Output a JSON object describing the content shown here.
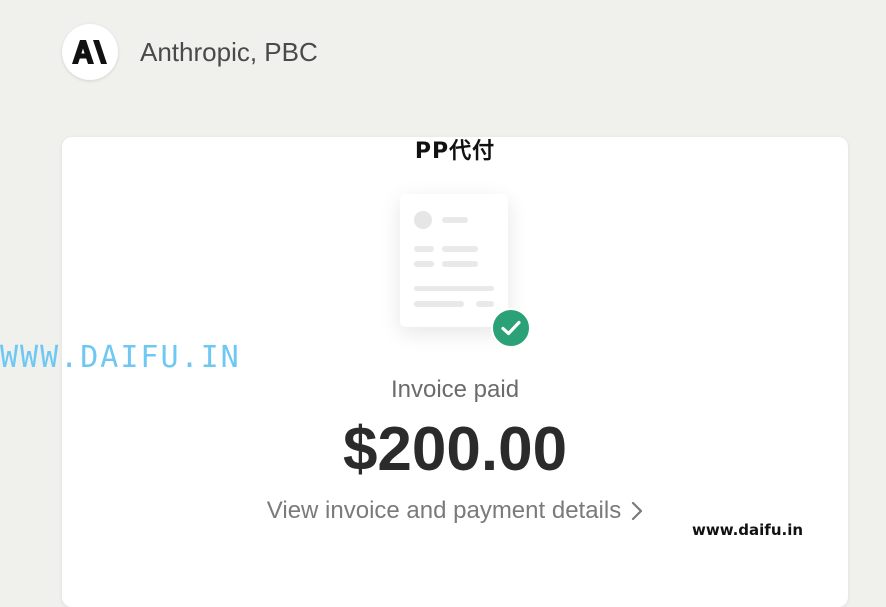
{
  "merchant": {
    "name": "Anthropic, PBC",
    "logo_icon": "anthropic-logo-icon"
  },
  "card": {
    "watermark_top": "PP代付",
    "illustration": {
      "icon": "receipt-icon",
      "badge_icon": "check-circle-icon",
      "badge_color": "#2aa177"
    },
    "status": "Invoice paid",
    "amount": "$200.00",
    "details_link": "View invoice and payment details"
  },
  "watermarks": {
    "left": "WWW.DAIFU.IN",
    "right": "www.daifu.in"
  },
  "colors": {
    "background": "#f0f0ed",
    "card": "#ffffff",
    "accent": "#2aa177"
  }
}
